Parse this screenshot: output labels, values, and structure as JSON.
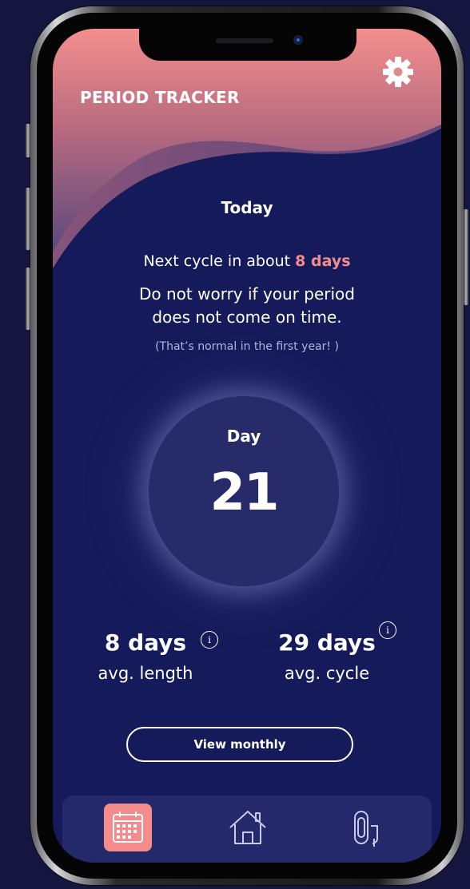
{
  "app": {
    "title": "PERIOD TRACKER"
  },
  "today": {
    "label": "Today",
    "next_cycle_prefix": "Next cycle in about ",
    "next_cycle_days": "8 days",
    "worry_line1": "Do not worry if your period",
    "worry_line2": "does not come on time.",
    "normal_note": "(That’s normal in the first year! )"
  },
  "day": {
    "label": "Day",
    "number": "21"
  },
  "stats": {
    "length_value": "8 days",
    "length_label": "avg. length",
    "cycle_value": "29 days",
    "cycle_label": "avg. cycle",
    "info_glyph": "i"
  },
  "actions": {
    "view_monthly_label": "View monthly"
  },
  "nav": {
    "active": "calendar",
    "icons": [
      "calendar-icon",
      "home-icon",
      "pad-tampon-icon"
    ]
  },
  "colors": {
    "background": "#151b5a",
    "wave_top": "#f08e8c",
    "wave_bottom": "#7a5680",
    "accent": "#f58b8a",
    "nav_bar": "#24296b"
  }
}
